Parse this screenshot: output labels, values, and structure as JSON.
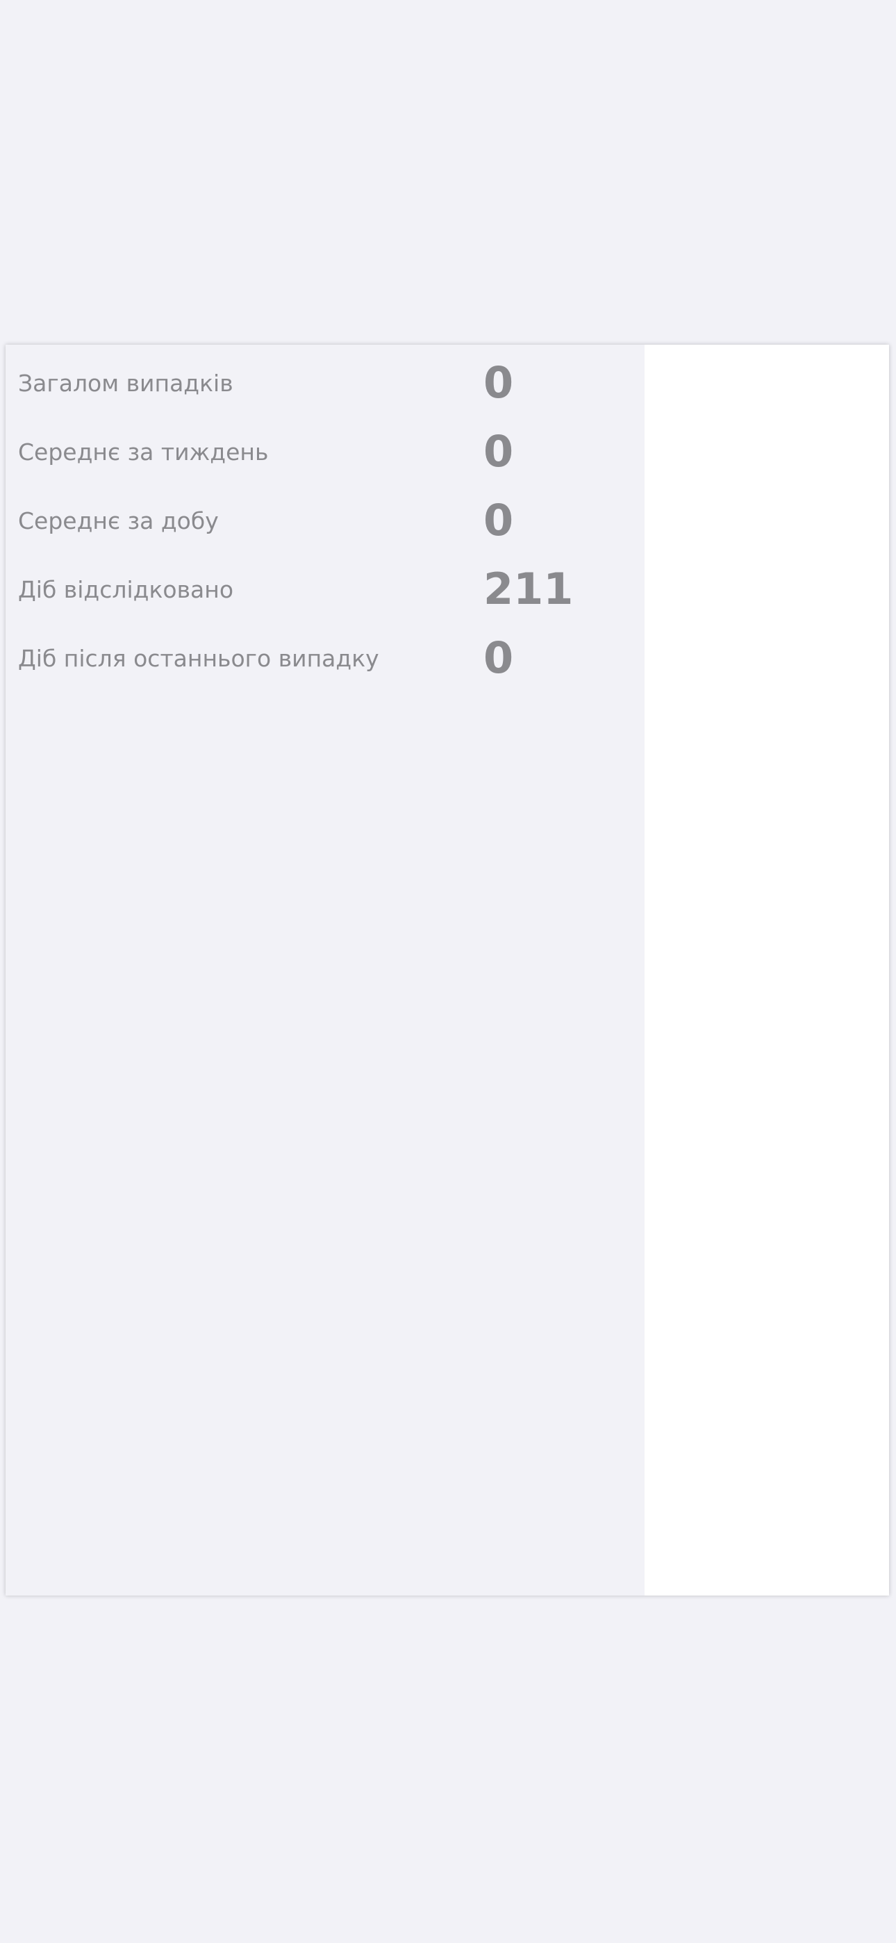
{
  "stats": [
    {
      "label": "Загалом випадків",
      "value": "0"
    },
    {
      "label": "Середнє за тиждень",
      "value": "0"
    },
    {
      "label": "Середнє за добу",
      "value": "0"
    },
    {
      "label": "Діб відслідковано",
      "value": "211"
    },
    {
      "label": "Діб після останнього випадку",
      "value": "0"
    }
  ],
  "colors": {
    "background": "#f2f2f7",
    "text": "#8a8a8e",
    "panel": "#ffffff"
  }
}
